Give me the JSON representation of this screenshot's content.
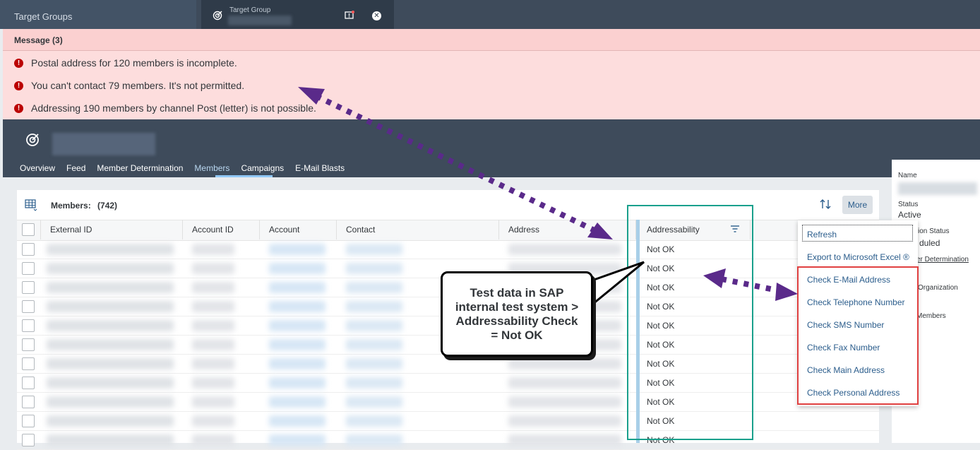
{
  "tabs": {
    "tab1_label": "Target Groups",
    "tab2_label": "Target Group"
  },
  "messages": {
    "header": "Message (3)",
    "items": [
      "Postal address for 120 members is incomplete.",
      "You can't contact 79 members. It's not permitted.",
      "Addressing 190 members by channel Post (letter) is not possible."
    ]
  },
  "nav": {
    "tabs": [
      "Overview",
      "Feed",
      "Member Determination",
      "Members",
      "Campaigns",
      "E-Mail Blasts"
    ],
    "active": "Members"
  },
  "members": {
    "title": "Members:",
    "count": "(742)",
    "more_label": "More",
    "columns": [
      "External ID",
      "Account ID",
      "Account",
      "Contact",
      "Address",
      "Addressability"
    ],
    "addressability_values": [
      "Not OK",
      "Not OK",
      "Not OK",
      "Not OK",
      "Not OK",
      "Not OK",
      "Not OK",
      "Not OK",
      "Not OK",
      "Not OK",
      "Not OK"
    ]
  },
  "menu": {
    "items": [
      "Refresh",
      "Export to Microsoft Excel ®",
      "Check E-Mail Address",
      "Check Telephone Number",
      "Check SMS Number",
      "Check Fax Number",
      "Check Main Address",
      "Check Personal Address"
    ]
  },
  "right_panel": {
    "name_label": "Name",
    "status_label": "Status",
    "status_value": "Active",
    "exec_status_label": "ion Status",
    "exec_status_value": "duled",
    "member_det_link": "er Determination",
    "org_label": "Organization",
    "members_label": "Members"
  },
  "callout": {
    "lines": [
      "Test data in SAP",
      "internal test system >",
      "Addressability Check",
      "= Not OK"
    ]
  },
  "colors": {
    "shell": "#3e4b5b",
    "message_bg": "#fddddd",
    "error_red": "#bb0000",
    "highlight_green": "#1aa08c",
    "highlight_red": "#e04040",
    "arrow_purple": "#5a2a8a",
    "link_blue": "#2b5d8c"
  }
}
